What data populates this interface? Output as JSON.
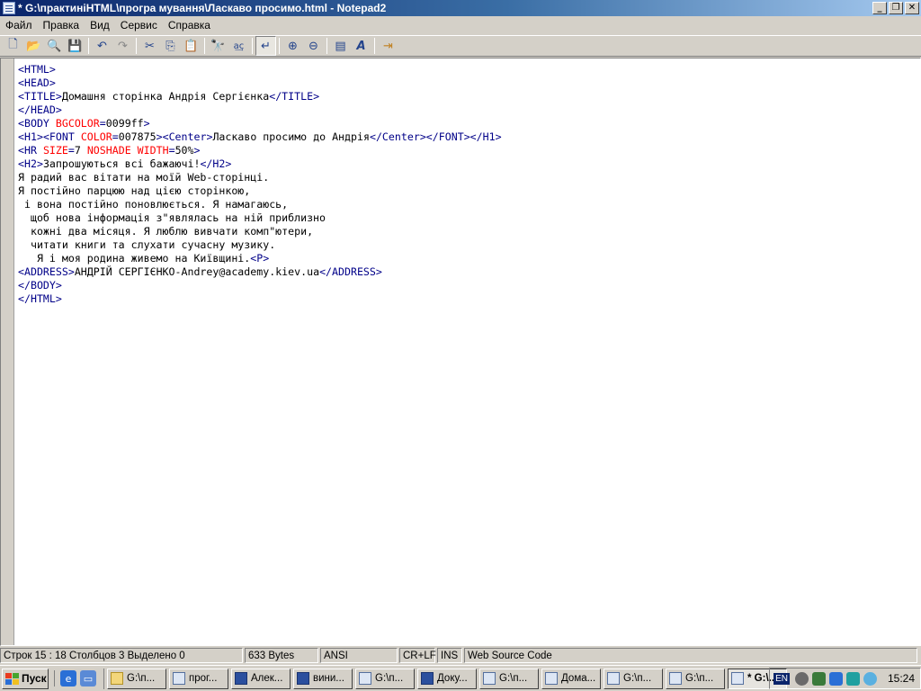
{
  "window": {
    "title": "* G:\\практиніHTML\\програ мування\\Ласкаво просимо.html - Notepad2",
    "minimize": "_",
    "maximize": "❐",
    "close": "✕"
  },
  "menu": [
    "Файл",
    "Правка",
    "Вид",
    "Сервис",
    "Справка"
  ],
  "toolbar_icons": [
    "new-file-icon",
    "open-folder-icon",
    "browse-icon",
    "save-icon",
    "undo-icon",
    "redo-icon",
    "cut-icon",
    "copy-icon",
    "paste-icon",
    "find-icon",
    "replace-icon",
    "word-wrap-icon",
    "zoom-in-icon",
    "zoom-out-icon",
    "scheme-icon",
    "font-icon",
    "exit-icon"
  ],
  "code_lines": [
    "<HTML>",
    "<HEAD>",
    "<TITLE>Домашня сторінка Андрія Сергієнка</TITLE>",
    "</HEAD>",
    "<BODY BGCOLOR=0099ff>",
    "<H1><FONT COLOR=007875><Center>Ласкаво просимо до Андрія</Center></FONT></H1>",
    "<HR SIZE=7 NOSHADE WIDTH=50%>",
    "<H2>Запрошуються всі бажаючі!</H2>",
    "Я радий вас вітати на моїй Web-сторінці.",
    "Я постійно парцюю над цією сторінкою,",
    " і вона постійно поновлюється. Я намагаюсь,",
    "  щоб нова інформація з\"являлась на ній приблизно",
    "  кожні два місяця. Я люблю вивчати комп\"ютери,",
    "  читати книги та слухати сучасну музику.",
    "   Я і моя родина живемо на Київщині.<P>",
    "<ADDRESS>АНДРІЙ СЕРГІЄНКО-Andrey@academy.kiev.ua</ADDRESS>",
    "</BODY>",
    "</HTML>"
  ],
  "status": {
    "position": "Строк 15 : 18   Столбцов 3   Выделено 0",
    "size": "633 Bytes",
    "encoding": "ANSI",
    "eol": "CR+LF",
    "mode": "INS",
    "scheme": "Web Source Code"
  },
  "taskbar": {
    "start": "Пуск",
    "tasks": [
      {
        "label": "G:\\п...",
        "icon": "folder"
      },
      {
        "label": "прог...",
        "icon": "doc"
      },
      {
        "label": "Алек...",
        "icon": "word"
      },
      {
        "label": "вини...",
        "icon": "word"
      },
      {
        "label": "G:\\п...",
        "icon": "doc"
      },
      {
        "label": "Доку...",
        "icon": "word"
      },
      {
        "label": "G:\\п...",
        "icon": "doc"
      },
      {
        "label": "Дома...",
        "icon": "doc"
      },
      {
        "label": "G:\\п...",
        "icon": "doc"
      },
      {
        "label": "G:\\п...",
        "icon": "doc"
      },
      {
        "label": "* G:\\...",
        "icon": "doc",
        "active": true
      }
    ],
    "lang": "EN",
    "clock": "15:24"
  },
  "colors": {
    "tag": "#000088",
    "attribute": "#ff0000",
    "title_start": "#0a246a",
    "title_end": "#a6caf0"
  }
}
